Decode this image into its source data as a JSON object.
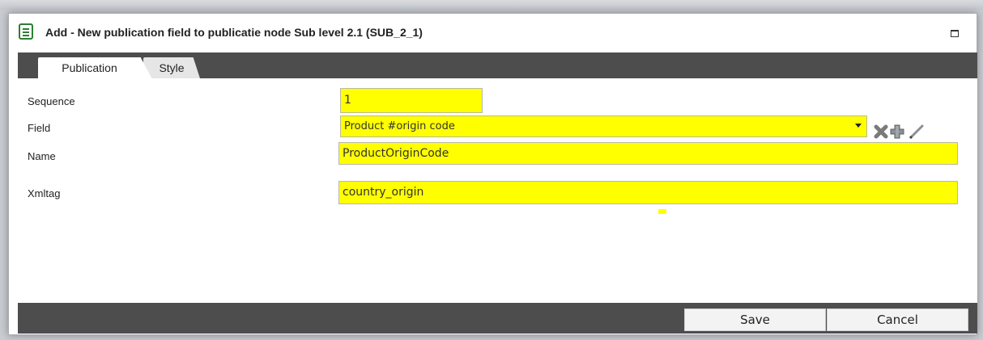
{
  "dialog": {
    "title": "Add - New publication field to publicatie node Sub level 2.1 (SUB_2_1)",
    "icons": {
      "title": "form-icon",
      "maximize": "maximize-icon"
    }
  },
  "tabs": [
    {
      "label": "Publication",
      "active": true
    },
    {
      "label": "Style",
      "active": false
    }
  ],
  "form": {
    "sequence": {
      "label": "Sequence",
      "value": "1"
    },
    "field": {
      "label": "Field",
      "value": "Product #origin code"
    },
    "name": {
      "label": "Name",
      "value": "ProductOriginCode"
    },
    "xmltag": {
      "label": "Xmltag",
      "value": "country_origin"
    },
    "field_actions": [
      "delete-icon",
      "add-icon",
      "edit-icon"
    ]
  },
  "footer": {
    "save_label": "Save",
    "cancel_label": "Cancel"
  },
  "colors": {
    "highlight": "#ffff00",
    "bar": "#4d4d4d"
  }
}
